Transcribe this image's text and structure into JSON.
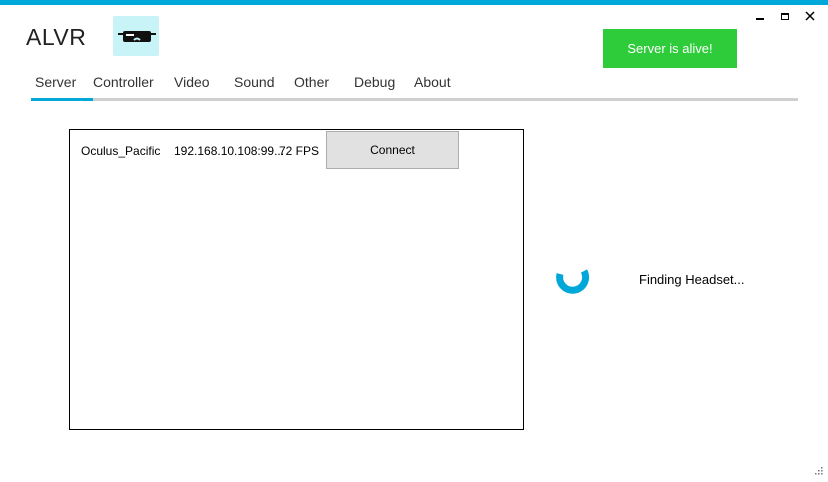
{
  "app": {
    "title": "ALVR"
  },
  "window": {
    "minimize_icon": "minimize-icon",
    "maximize_icon": "maximize-icon",
    "close_icon": "close-icon"
  },
  "status": {
    "text": "Server is alive!",
    "color": "#2ecc3a"
  },
  "tabs": [
    {
      "label": "Server",
      "selected": true
    },
    {
      "label": "Controller"
    },
    {
      "label": "Video"
    },
    {
      "label": "Sound"
    },
    {
      "label": "Other"
    },
    {
      "label": "Debug"
    },
    {
      "label": "About"
    }
  ],
  "devices": [
    {
      "name": "Oculus_Pacific",
      "address": "192.168.10.108:99...",
      "fps": "72 FPS",
      "action_label": "Connect"
    }
  ],
  "finding": {
    "text": "Finding Headset..."
  },
  "colors": {
    "accent": "#00a7d9",
    "logo_bg": "#c9f4f7"
  }
}
